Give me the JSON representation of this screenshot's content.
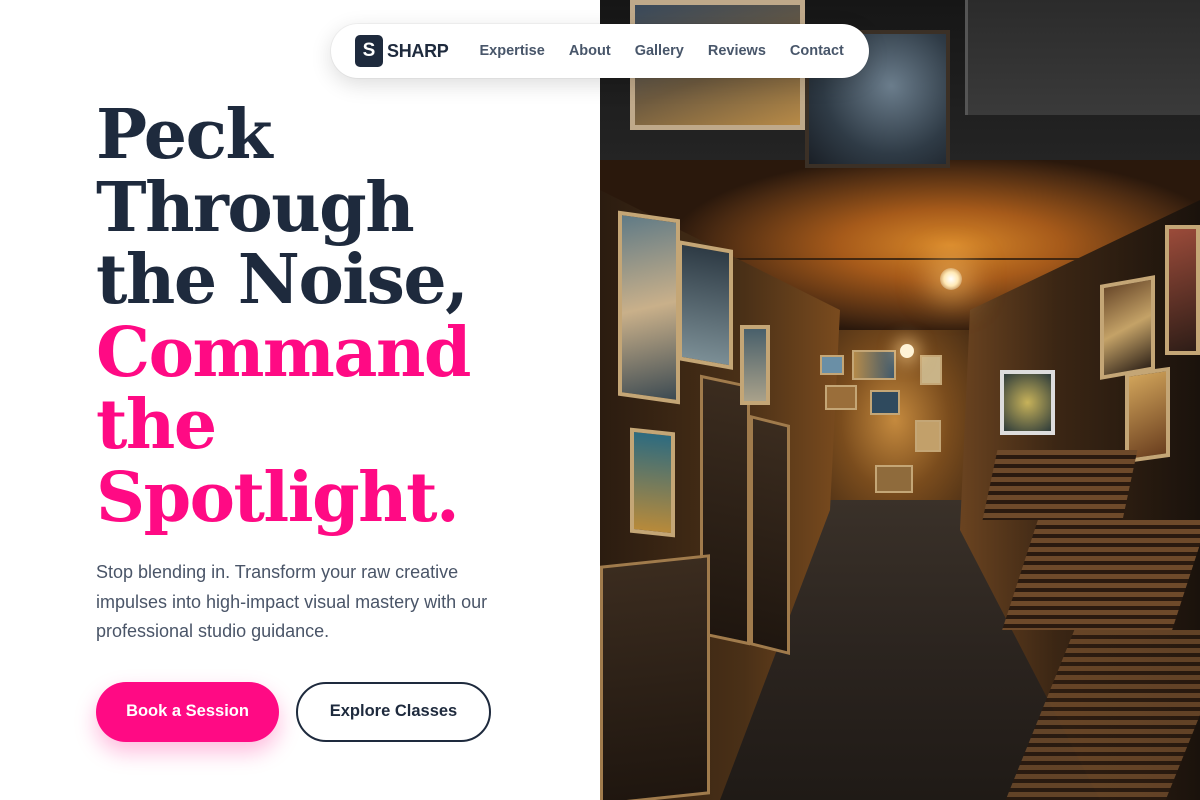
{
  "nav": {
    "logo_mark": "S",
    "logo_text": "SHARP",
    "links": [
      "Expertise",
      "About",
      "Gallery",
      "Reviews",
      "Contact"
    ]
  },
  "hero": {
    "headline_dark": [
      "Peck",
      "Through",
      "the Noise,"
    ],
    "headline_accent": [
      "Command",
      "the",
      "Spotlight."
    ],
    "lead": "Stop blending in. Transform your raw creative impulses into high-impact visual mastery with our professional studio guidance.",
    "primary_cta": "Book a Session",
    "secondary_cta": "Explore Classes"
  },
  "image": {
    "subject": "art-gallery-corridor-photo"
  },
  "colors": {
    "brand_dark": "#1e2a3d",
    "accent_pink": "#ff0a84",
    "nav_text": "#48566a",
    "body_text": "#4a5568"
  }
}
